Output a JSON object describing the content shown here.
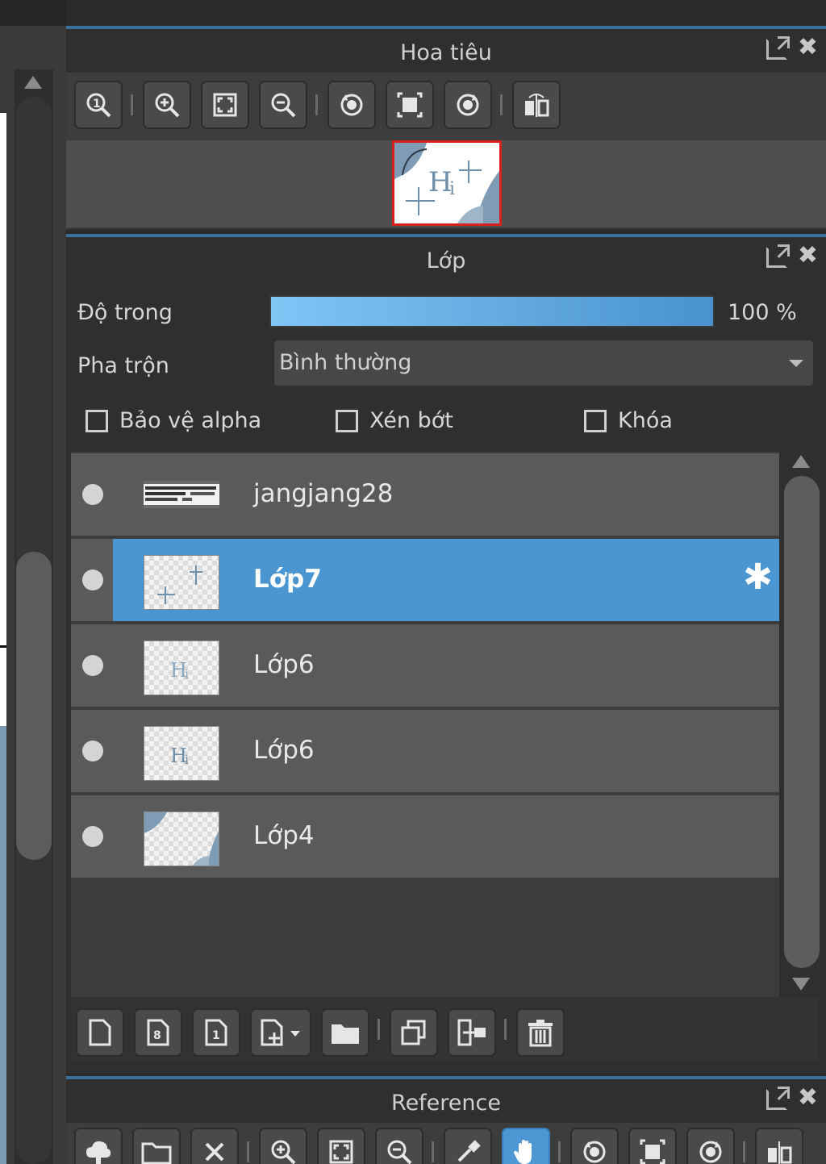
{
  "navigator": {
    "title": "Hoa tiêu"
  },
  "layers": {
    "title": "Lớp",
    "opacity_label": "Độ trong",
    "opacity_value": "100 %",
    "opacity_fraction": 1.0,
    "blend_label": "Pha trộn",
    "blend_value": "Bình thường",
    "checkboxes": {
      "protect_alpha": "Bảo vệ alpha",
      "clipping": "Xén bớt",
      "lock": "Khóa"
    },
    "items": [
      {
        "name": "jangjang28",
        "selected": false
      },
      {
        "name": "Lớp7",
        "selected": true
      },
      {
        "name": "Lớp6",
        "selected": false
      },
      {
        "name": "Lớp6",
        "selected": false
      },
      {
        "name": "Lớp4",
        "selected": false
      }
    ]
  },
  "reference": {
    "title": "Reference"
  },
  "colors": {
    "accent": "#4b96d1",
    "panel_border": "#3b6f9c",
    "nav_frame": "#d8211e",
    "row_bg": "#5a5a5a"
  }
}
